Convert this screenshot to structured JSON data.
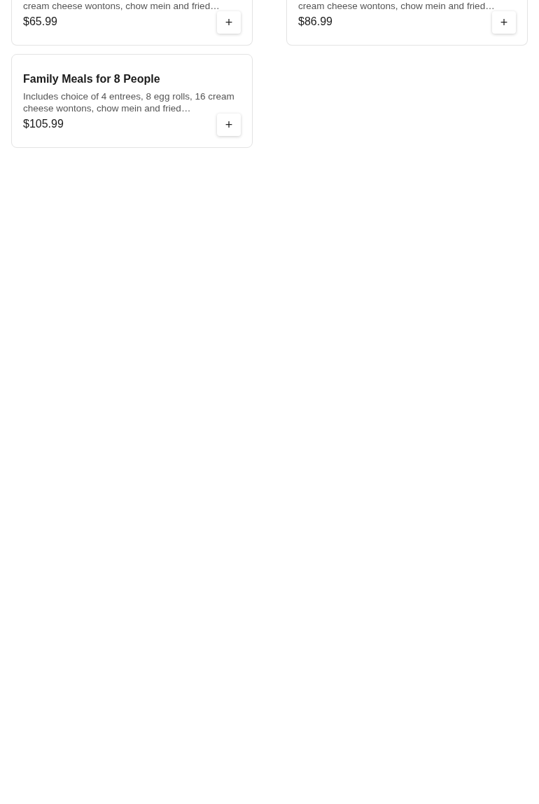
{
  "items": [
    {
      "description": "cream cheese wontons, chow mein and fried…",
      "price": "$65.99",
      "add_button": "+"
    },
    {
      "description": "cream cheese wontons, chow mein and fried…",
      "price": "$86.99",
      "add_button": "+"
    },
    {
      "title": "Family Meals for 8 People",
      "description": "Includes choice of 4 entrees, 8 egg rolls, 16 cream cheese wontons, chow mein and fried…",
      "price": "$105.99",
      "add_button": "+"
    }
  ]
}
